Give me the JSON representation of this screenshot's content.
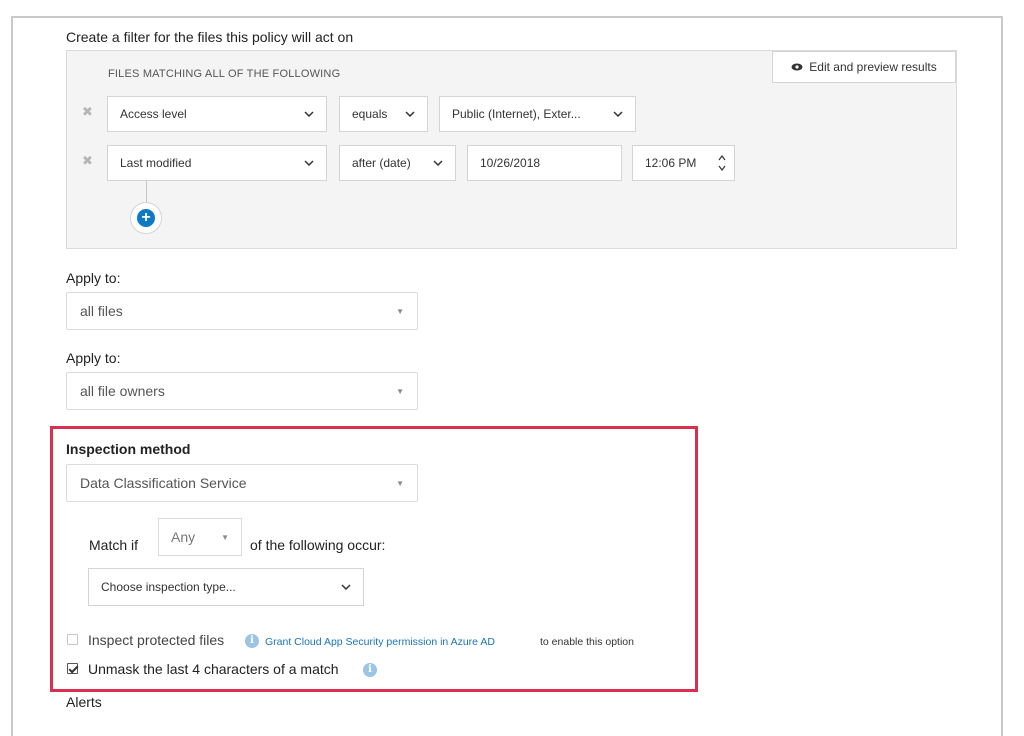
{
  "filter": {
    "heading": "Create a filter for the files this policy will act on",
    "panel_title": "FILES MATCHING ALL OF THE FOLLOWING",
    "preview_label": "Edit and preview results",
    "remove_glyph": "✖",
    "rows": [
      {
        "field": "Access level",
        "operator": "equals",
        "value": "Public (Internet), Exter..."
      },
      {
        "field": "Last modified",
        "operator": "after (date)",
        "date": "10/26/2018",
        "time": "12:06 PM"
      }
    ],
    "add_glyph": "+"
  },
  "apply_files": {
    "label": "Apply to:",
    "value": "all files"
  },
  "apply_owners": {
    "label": "Apply to:",
    "value": "all file owners"
  },
  "inspection": {
    "heading": "Inspection method",
    "method": "Data Classification Service",
    "match_prefix": "Match if",
    "match_value": "Any",
    "match_suffix": "of the following occur:",
    "type_placeholder": "Choose inspection type...",
    "protected_label": "Inspect protected files",
    "protected_link": "Grant Cloud App Security permission in Azure AD",
    "protected_suffix": "to enable this option",
    "protected_checked": false,
    "unmask_label": "Unmask the last 4 characters of a match",
    "unmask_checked": true,
    "info_glyph": "i"
  },
  "alerts": {
    "heading": "Alerts"
  },
  "colors": {
    "highlight": "#d9304f",
    "link": "#1a75bb",
    "accent": "#0e7ac4"
  },
  "icons": [
    "eye-icon",
    "remove-icon",
    "chevron-down-icon",
    "spinner-icon",
    "plus-icon",
    "caret-down-icon",
    "info-icon",
    "checkbox-icon"
  ]
}
